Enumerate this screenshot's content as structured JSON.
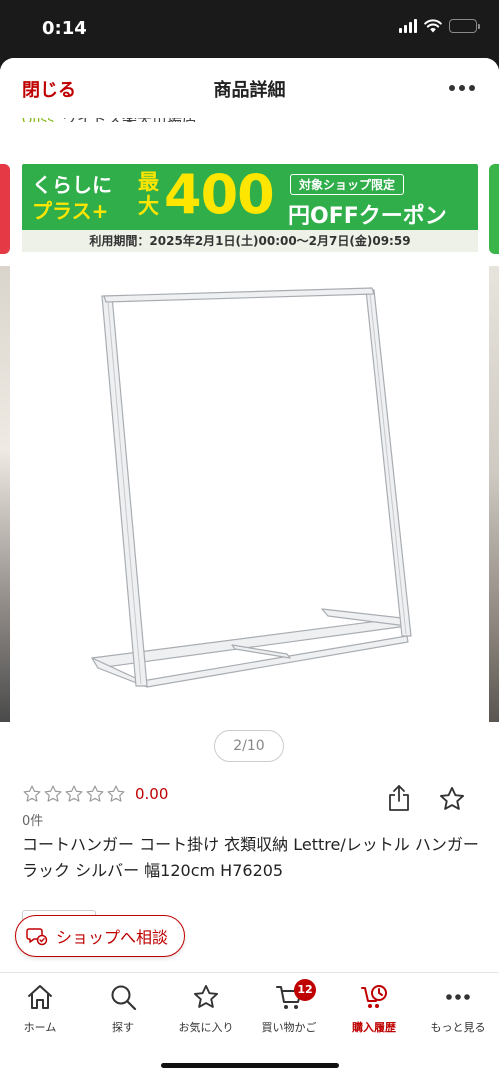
{
  "status_bar": {
    "time": "0:14",
    "battery_color": "#e54b3c"
  },
  "header": {
    "close_label": "閉じる",
    "title": "商品詳細",
    "more_icon": "more-horizontal-icon"
  },
  "shop": {
    "prefix": "Ofiss",
    "name": "ワイドス楽天市場店"
  },
  "banner": {
    "left_line1": "くらしに",
    "left_line2": "プラス+",
    "mid_line1": "最",
    "mid_line2": "大",
    "amount": "400",
    "tag": "対象ショップ限定",
    "off_text": "円OFFクーポン",
    "period": "利用期間：2025年2月1日(土)00:00〜2月7日(金)09:59",
    "color": "#2fae4a"
  },
  "gallery": {
    "pager": "2/10"
  },
  "product": {
    "rating_value": "0.00",
    "rating_stars": 0,
    "review_count": "0件",
    "title": "コートハンガー コート掛け 衣類収納 Lettre/レットル ハンガーラック シルバー 幅120cm H76205"
  },
  "consult_button": {
    "label": "ショップへ相談"
  },
  "tabbar": {
    "items": [
      {
        "label": "ホーム",
        "icon": "home-icon"
      },
      {
        "label": "探す",
        "icon": "search-icon"
      },
      {
        "label": "お気に入り",
        "icon": "star-icon"
      },
      {
        "label": "買い物かご",
        "icon": "cart-icon",
        "badge": "12"
      },
      {
        "label": "購入履歴",
        "icon": "purchase-history-icon",
        "active": true
      },
      {
        "label": "もっと見る",
        "icon": "more-horizontal-icon"
      }
    ]
  },
  "colors": {
    "accent": "#bf0000",
    "banner_green": "#2fae4a",
    "banner_yellow": "#ffe600"
  }
}
